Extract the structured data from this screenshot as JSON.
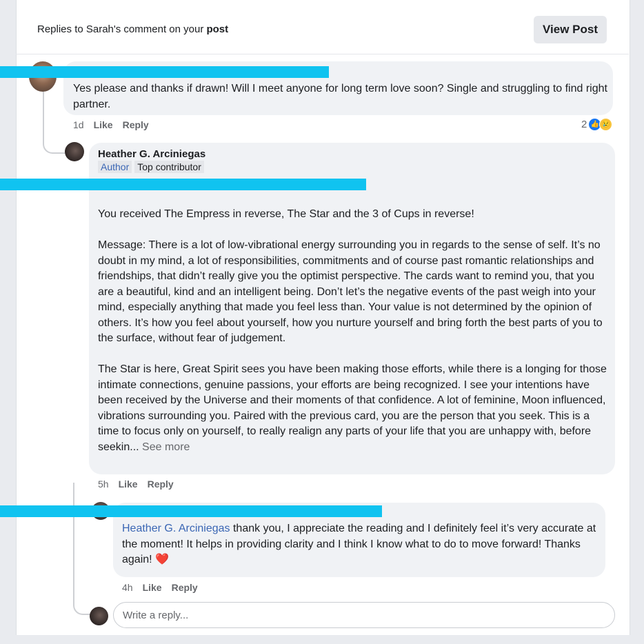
{
  "header": {
    "title_prefix": "Replies to Sarah's comment on your ",
    "title_bold": "post",
    "view_button": "View Post"
  },
  "comment1": {
    "text": "Yes please and thanks if drawn!  Will I meet anyone for long term love soon?  Single and struggling to find right partner.",
    "time": "1d",
    "like": "Like",
    "reply": "Reply",
    "reaction_count": "2",
    "reactions": [
      "like-icon",
      "sad-icon"
    ]
  },
  "comment2": {
    "author": "Heather G. Arciniegas",
    "badge_author": "Author",
    "badge_top": "Top contributor",
    "para1": "You received The Empress in reverse, The Star and the 3 of Cups in reverse!",
    "para2": "Message: There is a lot of low-vibrational energy surrounding you in regards to the sense of self. It’s no doubt in my mind, a lot of responsibilities, commitments and of course past romantic relationships and friendships, that didn’t really give you the optimist perspective. The cards want to remind you, that you are a beautiful, kind and an intelligent being. Don’t let’s the negative events of the past weigh into your mind, especially anything that made you feel less than. Your value is not determined by the opinion of others. It’s how you feel about yourself, how you nurture yourself and bring forth the best parts of you to the surface, without fear of judgement.",
    "para3": "The Star is here, Great Spirit sees you have been making those efforts, while there is a longing for those intimate connections, genuine passions, your efforts are being recognized. I see your intentions have been received by the Universe and their moments of that confidence. A lot of feminine, Moon influenced, vibrations surrounding you. Paired with the previous card, you are the person that you seek. This is a time to focus only on yourself, to really realign any parts of your life that you are unhappy with, before seekin...",
    "see_more": "See more",
    "time": "5h",
    "like": "Like",
    "reply": "Reply"
  },
  "comment3": {
    "mention": "Heather G. Arciniegas",
    "text": " thank you, I appreciate the reading and I definitely feel it’s very accurate at the moment!  It helps in providing clarity and I think I know what to do to move forward!  Thanks again! ",
    "emoji": "❤️",
    "time": "4h",
    "like": "Like",
    "reply": "Reply"
  },
  "reply_box": {
    "placeholder": "Write a reply..."
  }
}
